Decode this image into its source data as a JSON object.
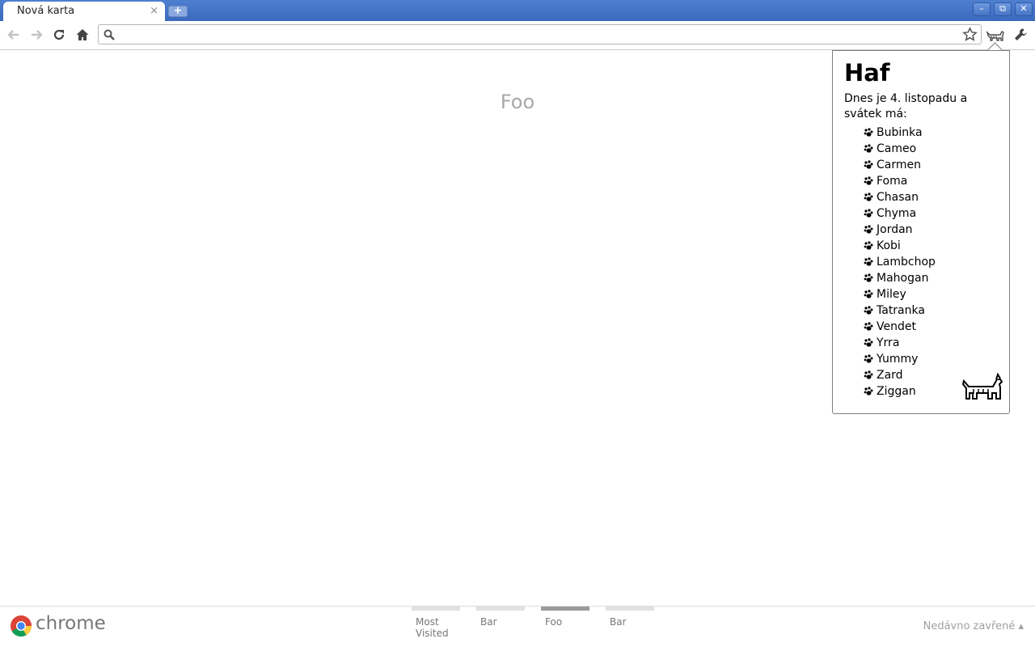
{
  "window": {
    "tab_title": "Nová karta",
    "tab_close": "×",
    "new_tab": "+",
    "minimize": "–",
    "restore": "⧉",
    "close": "✕"
  },
  "toolbar": {
    "omnibox_value": "",
    "omnibox_placeholder": "",
    "icons": [
      "back-icon",
      "forward-icon",
      "reload-icon",
      "home-icon",
      "search-icon",
      "star-icon",
      "extension-dog-icon",
      "wrench-icon"
    ]
  },
  "page": {
    "title": "Foo"
  },
  "popup": {
    "heading": "Haf",
    "intro": "Dnes je 4. listopadu a svátek má:",
    "names": [
      "Bubinka",
      "Cameo",
      "Carmen",
      "Foma",
      "Chasan",
      "Chyma",
      "Jordan",
      "Kobi",
      "Lambchop",
      "Mahogan",
      "Miley",
      "Tatranka",
      "Vendet",
      "Yrra",
      "Yummy",
      "Zard",
      "Ziggan"
    ]
  },
  "bottom": {
    "brand": "chrome",
    "panes": [
      {
        "label": "Most Visited",
        "active": false
      },
      {
        "label": "Bar",
        "active": false
      },
      {
        "label": "Foo",
        "active": true
      },
      {
        "label": "Bar",
        "active": false
      }
    ],
    "recently_closed": "Nedávno zavřené ▴"
  },
  "colors": {
    "titlebar": "#3a69be",
    "page_title": "#a8a8a8",
    "active_pane": "#9b9b9b"
  }
}
